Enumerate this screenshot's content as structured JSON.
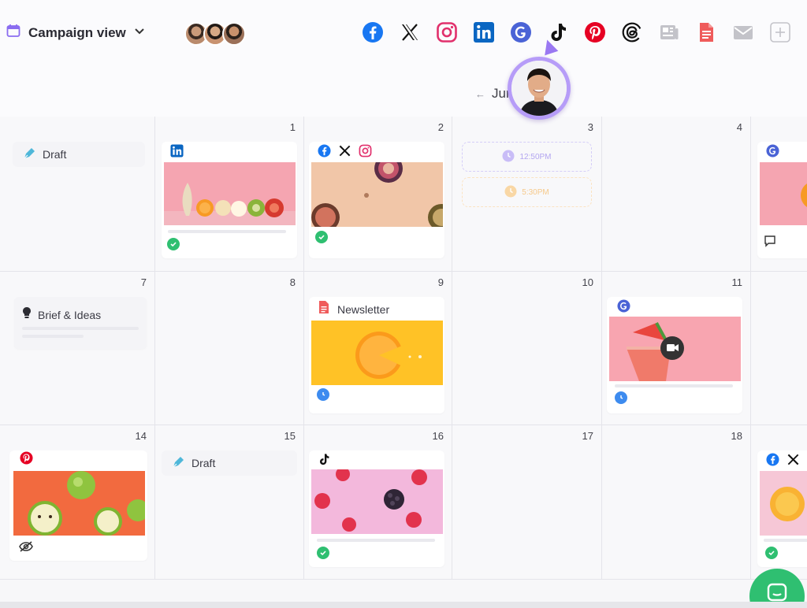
{
  "header": {
    "view_label": "Campaign view",
    "calendar_icon": "calendar-icon",
    "chevron_icon": "chevron-down-icon",
    "collaborators": [
      "avatar-1",
      "avatar-2",
      "avatar-3"
    ],
    "channels": [
      {
        "name": "facebook",
        "icon": "facebook-icon",
        "color": "#1877f2"
      },
      {
        "name": "x",
        "icon": "x-icon",
        "color": "#111111"
      },
      {
        "name": "instagram",
        "icon": "instagram-icon",
        "color": "#e1306c"
      },
      {
        "name": "linkedin",
        "icon": "linkedin-icon",
        "color": "#0a66c2"
      },
      {
        "name": "google",
        "icon": "google-icon",
        "color": "#3b5bdb"
      },
      {
        "name": "tiktok",
        "icon": "tiktok-icon",
        "color": "#111111"
      },
      {
        "name": "pinterest",
        "icon": "pinterest-icon",
        "color": "#e60023"
      },
      {
        "name": "threads",
        "icon": "threads-icon",
        "color": "#111111"
      },
      {
        "name": "news",
        "icon": "newspaper-icon",
        "color": "#c3c3c9"
      },
      {
        "name": "newsletter",
        "icon": "document-icon",
        "color": "#ef5b5b"
      },
      {
        "name": "email",
        "icon": "mail-icon",
        "color": "#c3c3c9"
      },
      {
        "name": "add",
        "icon": "plus-icon",
        "color": "#c3c3c9"
      }
    ]
  },
  "calendar": {
    "month_label": "Jun",
    "prev_arrow": "←",
    "days": {
      "d1": "1",
      "d2": "2",
      "d3": "3",
      "d4": "4",
      "d7": "7",
      "d8": "8",
      "d9": "9",
      "d10": "10",
      "d11": "11",
      "d14": "14",
      "d15": "15",
      "d16": "16",
      "d17": "17",
      "d18": "18"
    },
    "labels": {
      "draft": "Draft",
      "brief": "Brief & Ideas",
      "newsletter": "Newsletter",
      "draft2": "Draft"
    },
    "ghost_slots": [
      {
        "time": "12:50PM",
        "color": "#b3a6f0"
      },
      {
        "time": "5:30PM",
        "color": "#f6c98a"
      }
    ]
  },
  "colors": {
    "status_ok": "#2fbf71",
    "status_scheduled": "#3d8bef",
    "accent_purple": "#9a78f2",
    "fab": "#2fbf71"
  }
}
